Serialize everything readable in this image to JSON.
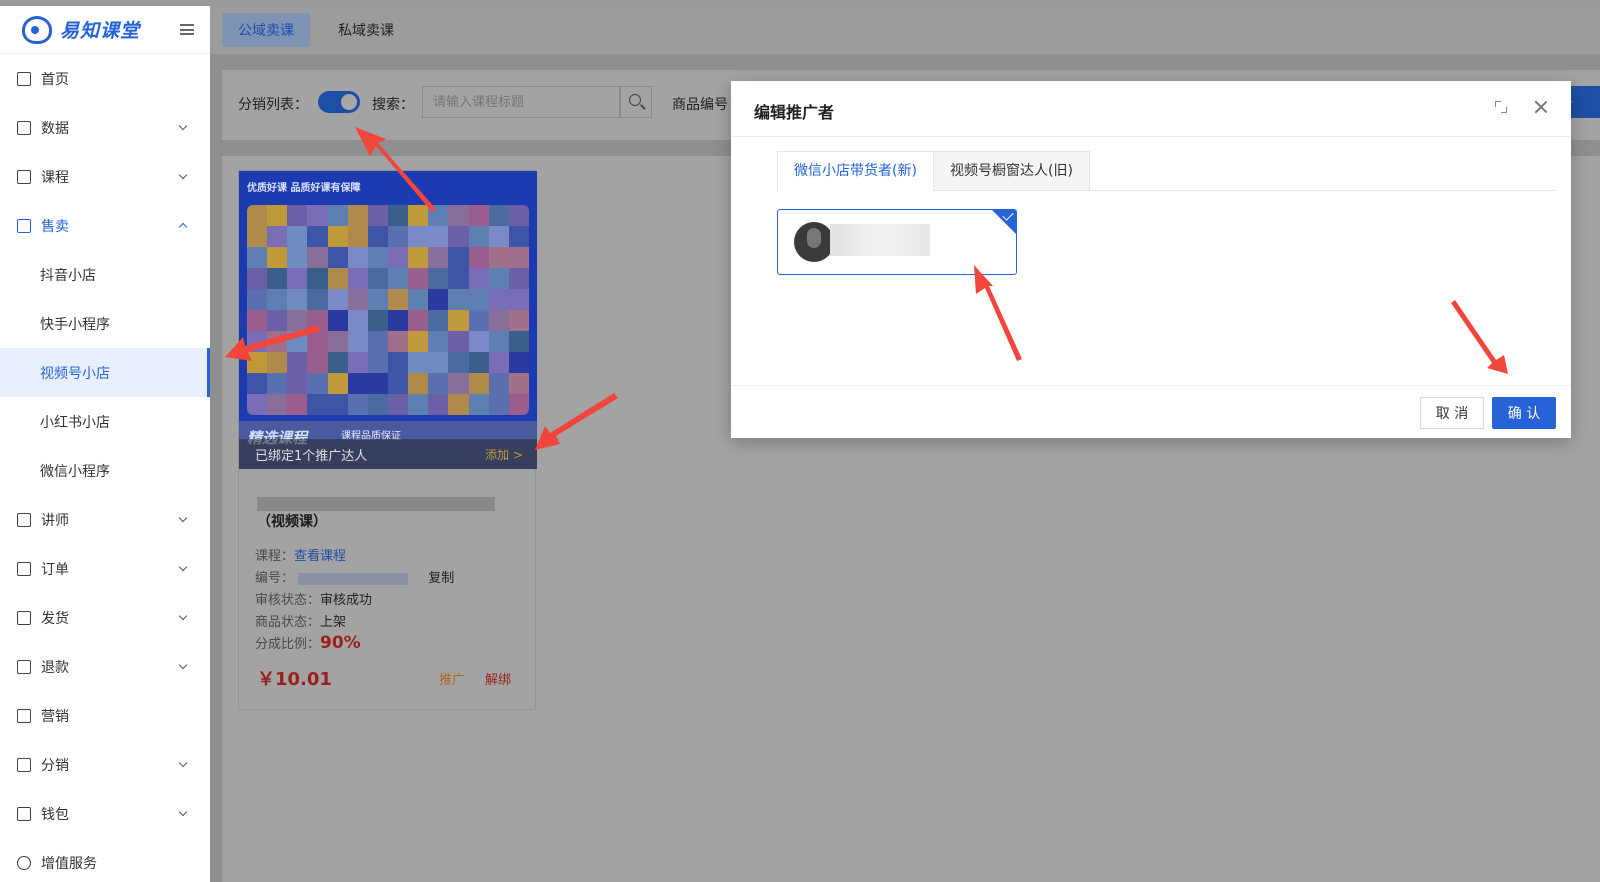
{
  "logo": {
    "text": "易知课堂"
  },
  "sidebar": {
    "items": [
      {
        "label": "首页",
        "icon": "home-icon"
      },
      {
        "label": "数据",
        "icon": "monitor-icon"
      },
      {
        "label": "课程",
        "icon": "grid-icon"
      },
      {
        "label": "售卖",
        "icon": "shop-icon"
      },
      {
        "label": "讲师",
        "icon": "id-card-icon"
      },
      {
        "label": "订单",
        "icon": "order-icon"
      },
      {
        "label": "发货",
        "icon": "printer-icon"
      },
      {
        "label": "退款",
        "icon": "refund-icon"
      },
      {
        "label": "营销",
        "icon": "bag-icon"
      },
      {
        "label": "分销",
        "icon": "share-icon"
      },
      {
        "label": "钱包",
        "icon": "wallet-icon"
      },
      {
        "label": "增值服务",
        "icon": "search-icon"
      }
    ],
    "sub_items": [
      "抖音小店",
      "快手小程序",
      "视频号小店",
      "小红书小店",
      "微信小程序"
    ]
  },
  "topbar": {
    "tabs": [
      "公域卖课",
      "私域卖课"
    ]
  },
  "filter": {
    "list_label": "分销列表：",
    "search_label": "搜索：",
    "search_placeholder": "请输入课程标题",
    "goods_label": "商品编号",
    "add_symbol": "+"
  },
  "card": {
    "brand": "优质好课  品质好课有保障",
    "banner_title": "精选课程",
    "banner_badge": "课程品质保证",
    "overlay_text": "已绑定1个推广达人",
    "overlay_add": "添加 >",
    "title2": "（视频课）",
    "course_k": "课程：",
    "course_link": "查看课程",
    "code_k": "编号：",
    "copy": "复制",
    "audit_k": "审核状态：",
    "audit_v": "审核成功",
    "goods_k": "商品状态：",
    "goods_v": "上架",
    "ratio_k": "分成比例：",
    "ratio_v": "90%",
    "price": "￥10.01",
    "promote": "推广",
    "unbind": "解绑"
  },
  "modal": {
    "title": "编辑推广者",
    "tabs": [
      "微信小店带货者(新)",
      "视频号橱窗达人(旧)"
    ],
    "cancel": "取 消",
    "ok": "确 认"
  },
  "colors": {
    "accent": "#2563d6",
    "price": "#d92e2e",
    "promote": "#f08a24"
  }
}
